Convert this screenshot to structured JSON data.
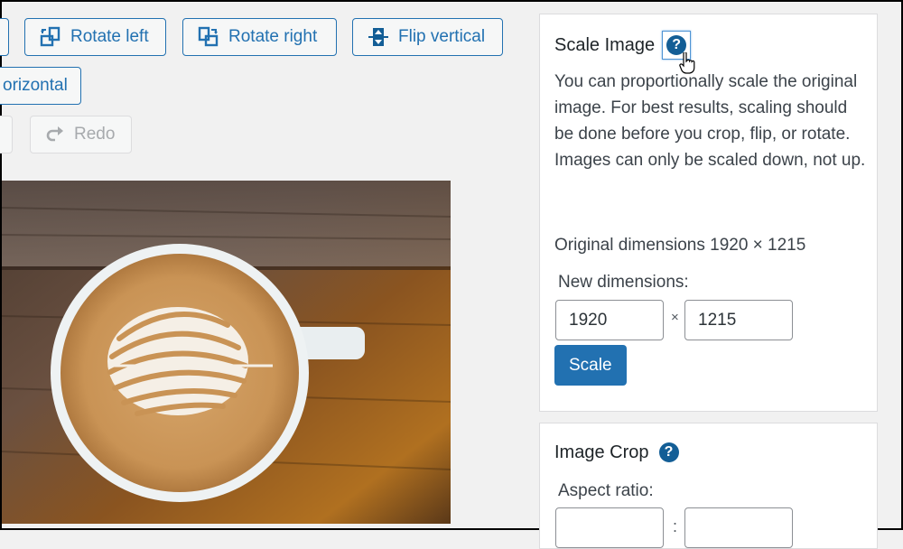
{
  "toolbar": {
    "rotate_left": "Rotate left",
    "rotate_right": "Rotate right",
    "flip_vertical": "Flip vertical",
    "flip_horizontal_partial": "orizontal",
    "redo": "Redo"
  },
  "image": {
    "description": "Latte art coffee cup on wooden table"
  },
  "scale_panel": {
    "title": "Scale Image",
    "help_icon": "question-circle",
    "description": "You can proportionally scale the original image. For best results, scaling should be done before you crop, flip, or rotate. Images can only be scaled down, not up.",
    "original_dimensions": "Original dimensions 1920 × 1215",
    "new_dimensions_label": "New dimensions:",
    "width_value": "1920",
    "height_value": "1215",
    "separator": "×",
    "scale_button": "Scale"
  },
  "crop_panel": {
    "title": "Image Crop",
    "help_icon": "question-circle",
    "aspect_ratio_label": "Aspect ratio:",
    "ratio_width_value": "",
    "ratio_height_value": "",
    "separator": ":"
  },
  "colors": {
    "accent": "#2271b1",
    "help_icon": "#135e96",
    "background": "#f1f1f1"
  }
}
